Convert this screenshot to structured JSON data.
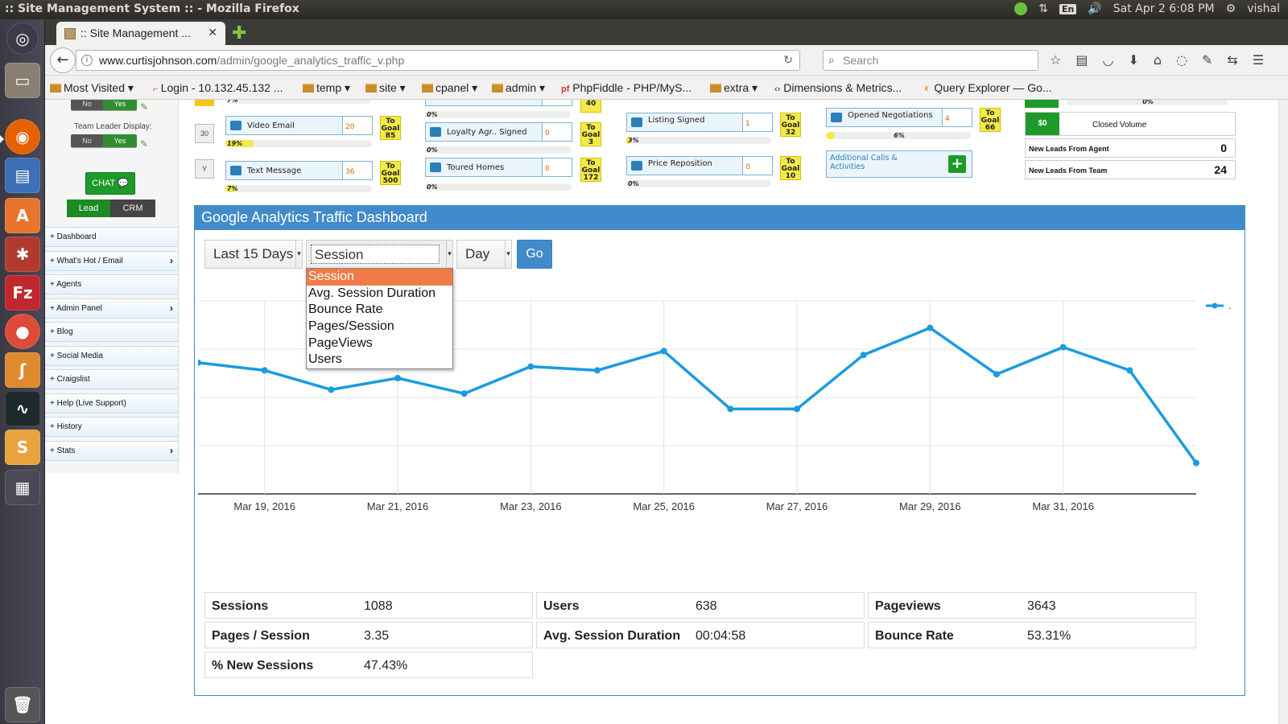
{
  "window": {
    "title": ":: Site Management System :: - Mozilla Firefox",
    "tray": {
      "lang": "En",
      "datetime": "Sat Apr  2  6:08 PM",
      "user": "vishal"
    }
  },
  "launcher": {
    "items": [
      "dash-icon",
      "files-icon",
      "firefox-icon",
      "writer-icon",
      "software-center-icon",
      "settings-icon",
      "filezilla-icon",
      "chrome-icon",
      "ubuntu-one-icon",
      "system-monitor-icon",
      "sublime-icon",
      "workspaces-icon",
      "trash-icon"
    ]
  },
  "browser": {
    "tab_title": ":: Site Management ...",
    "url_host": "www.curtisjohnson.com",
    "url_path": "/admin/google_analytics_traffic_v.php",
    "search_placeholder": "Search",
    "bookmarks": [
      "Most Visited",
      "Login - 10.132.45.132 ...",
      "temp",
      "site",
      "cpanel",
      "admin",
      "PhpFiddle - PHP/MyS...",
      "extra",
      "Dimensions & Metrics...",
      "Query Explorer — Go..."
    ]
  },
  "sidebar": {
    "toggle_no": "No",
    "toggle_yes": "Yes",
    "team_leader_label": "Team Leader Display:",
    "chat_label": "CHAT",
    "lead_label": "Lead",
    "crm_label": "CRM",
    "menu": [
      {
        "label": "Dashboard",
        "chevron": false
      },
      {
        "label": "What's Hot / Email",
        "chevron": true
      },
      {
        "label": "Agents",
        "chevron": false
      },
      {
        "label": "Admin Panel",
        "chevron": true
      },
      {
        "label": "Blog",
        "chevron": false
      },
      {
        "label": "Social Media",
        "chevron": false
      },
      {
        "label": "Craigslist",
        "chevron": false
      },
      {
        "label": "Help (Live Support)",
        "chevron": false
      },
      {
        "label": "History",
        "chevron": false
      },
      {
        "label": "Stats",
        "chevron": true
      }
    ]
  },
  "metrics": {
    "row_labels": [
      "30",
      "Y"
    ],
    "top_partial": {
      "pct_a": "7%",
      "pct_b": "0%",
      "goal_b": "40",
      "pct_d": "0%"
    },
    "video_email": {
      "label": "Video Email",
      "value": "20",
      "goal": "To Goal 85",
      "pct": "19%"
    },
    "text_message": {
      "label": "Text Message",
      "value": "36",
      "goal": "To Goal 500",
      "pct": "7%"
    },
    "loyalty": {
      "label": "Loyalty Agr.. Signed",
      "value": "0",
      "goal": "To Goal 3",
      "pct": "0%"
    },
    "toured": {
      "label": "Toured Homes",
      "value": "0",
      "goal": "To Goal 172",
      "pct": "0%"
    },
    "listing_signed": {
      "label": "Listing Signed",
      "value": "1",
      "goal": "To Goal 32",
      "pct": "3%"
    },
    "price_repos": {
      "label": "Price Reposition",
      "value": "0",
      "goal": "To Goal 10",
      "pct": "0%"
    },
    "opened_neg": {
      "label": "Opened Negotiations",
      "value": "4",
      "goal": "To Goal 66",
      "pct": "6%"
    },
    "additional_calls": {
      "label": "Additional Calls & Activities"
    },
    "right": {
      "closed_pct": "0%",
      "closed_amount": "$0",
      "closed_label": "Closed Volume",
      "leads_agent_label": "New Leads From Agent",
      "leads_agent_value": "0",
      "leads_team_label": "New Leads From Team",
      "leads_team_value": "24"
    }
  },
  "ga": {
    "title": "Google Analytics Traffic Dashboard",
    "range_value": "Last 15 Days",
    "metric_value": "Session",
    "interval_value": "Day",
    "go_label": "Go",
    "metric_options": [
      "Session",
      "Avg. Session Duration",
      "Bounce Rate",
      "Pages/Session",
      "PageViews",
      "Users"
    ],
    "legend_text": ".",
    "stats": [
      {
        "key": "Sessions",
        "value": "1088"
      },
      {
        "key": "Users",
        "value": "638"
      },
      {
        "key": "Pageviews",
        "value": "3643"
      },
      {
        "key": "Pages / Session",
        "value": "3.35"
      },
      {
        "key": "Avg. Session Duration",
        "value": "00:04:58"
      },
      {
        "key": "Bounce Rate",
        "value": "53.31%"
      },
      {
        "key": "% New Sessions",
        "value": "47.43%"
      }
    ],
    "accent": "#1a9be0"
  },
  "chart_data": {
    "type": "line",
    "title": "",
    "xlabel": "",
    "ylabel": "",
    "tick_labels": [
      "Mar 19, 2016",
      "Mar 21, 2016",
      "Mar 23, 2016",
      "Mar 25, 2016",
      "Mar 27, 2016",
      "Mar 29, 2016",
      "Mar 31, 2016"
    ],
    "x": [
      "2016-03-18",
      "2016-03-19",
      "2016-03-20",
      "2016-03-21",
      "2016-03-22",
      "2016-03-23",
      "2016-03-24",
      "2016-03-25",
      "2016-03-26",
      "2016-03-27",
      "2016-03-28",
      "2016-03-29",
      "2016-03-30",
      "2016-03-31",
      "2016-04-01",
      "2016-04-02"
    ],
    "series": [
      {
        "values": [
          74,
          72,
          67,
          70,
          66,
          73,
          72,
          77,
          62,
          62,
          76,
          83,
          71,
          78,
          72,
          48
        ]
      }
    ],
    "ylim": [
      40,
      90
    ],
    "grid": true
  }
}
